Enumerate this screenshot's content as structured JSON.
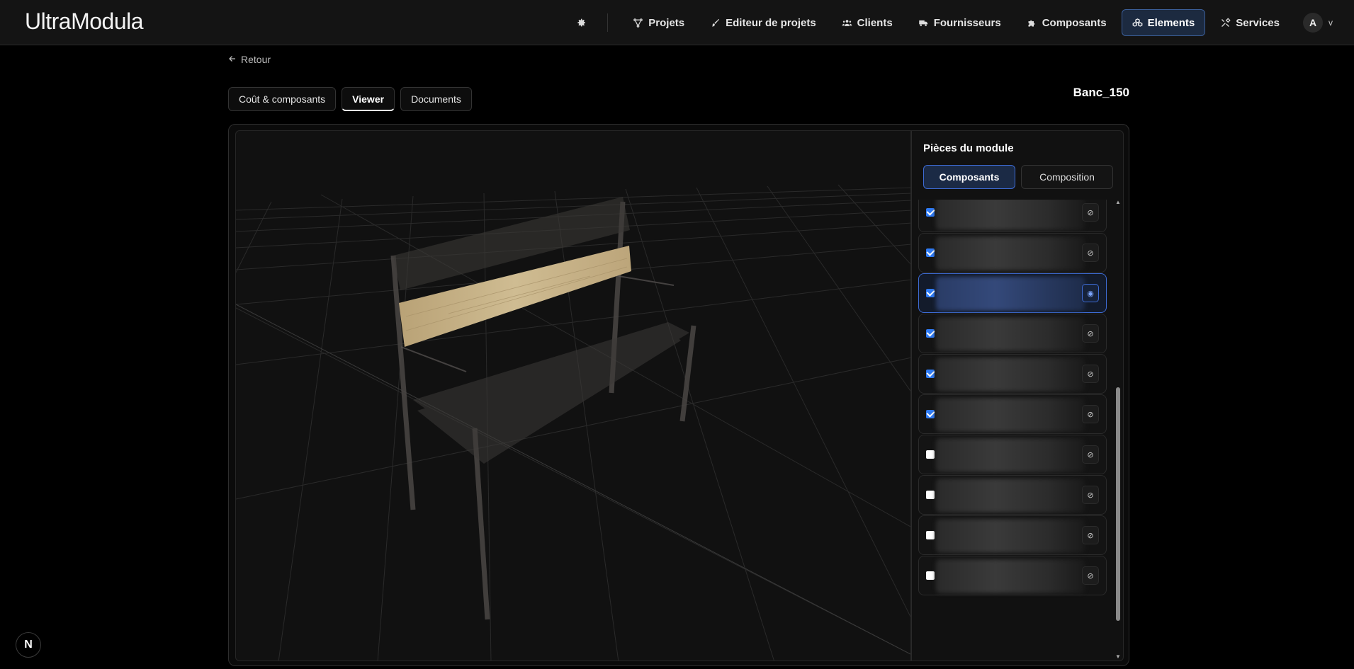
{
  "brand": "UltraModula",
  "nav": {
    "items": [
      {
        "label": "Projets",
        "icon": "project-graph-icon"
      },
      {
        "label": "Editeur de projets",
        "icon": "brush-icon"
      },
      {
        "label": "Clients",
        "icon": "users-icon"
      },
      {
        "label": "Fournisseurs",
        "icon": "truck-icon"
      },
      {
        "label": "Composants",
        "icon": "puzzle-icon"
      },
      {
        "label": "Elements",
        "icon": "blocks-icon",
        "active": true
      },
      {
        "label": "Services",
        "icon": "tools-icon"
      }
    ],
    "avatar_initial": "A",
    "avatar_caret": "v"
  },
  "back_label": "Retour",
  "tabs": [
    {
      "label": "Coût & composants"
    },
    {
      "label": "Viewer",
      "active": true
    },
    {
      "label": "Documents"
    }
  ],
  "module_title": "Banc_150",
  "panel": {
    "title": "Pièces du module",
    "segments": [
      {
        "label": "Composants",
        "active": true
      },
      {
        "label": "Composition"
      }
    ],
    "items": [
      {
        "checked": true,
        "visible": false,
        "selected": false
      },
      {
        "checked": true,
        "visible": false,
        "selected": false
      },
      {
        "checked": true,
        "visible": true,
        "selected": true
      },
      {
        "checked": true,
        "visible": false,
        "selected": false
      },
      {
        "checked": true,
        "visible": false,
        "selected": false
      },
      {
        "checked": true,
        "visible": false,
        "selected": false
      },
      {
        "checked": false,
        "visible": false,
        "selected": false
      },
      {
        "checked": false,
        "visible": false,
        "selected": false
      },
      {
        "checked": false,
        "visible": false,
        "selected": false
      },
      {
        "checked": false,
        "visible": false,
        "selected": false
      }
    ]
  },
  "colors": {
    "accent": "#3d6bd4",
    "checkbox_on": "#2f7bf5",
    "wood": "#c9b48a"
  },
  "badge_letter": "N"
}
